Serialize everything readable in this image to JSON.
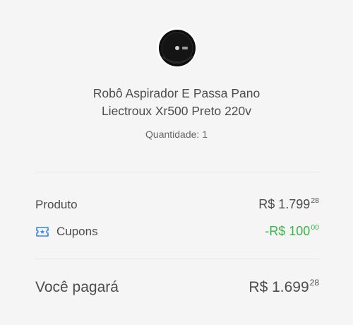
{
  "product": {
    "image_icon": "robot-vacuum",
    "title_line1": "Robô Aspirador E Passa Pano",
    "title_line2": "Liectroux Xr500 Preto 220v",
    "quantity": "Quantidade: 1"
  },
  "summary": {
    "product_label": "Produto",
    "product_price_main": "R$ 1.799",
    "product_price_cents": "28",
    "coupons_icon": "ticket-star-icon",
    "coupons_label": "Cupons",
    "coupons_price_main": "-R$ 100",
    "coupons_price_cents": "00",
    "total_label": "Você pagará",
    "total_price_main": "R$ 1.699",
    "total_price_cents": "28"
  },
  "colors": {
    "background": "#f5f5f5",
    "text": "#4d4d4d",
    "discount": "#39b54a",
    "coupon_icon": "#3483fa",
    "divider": "#e6e6e6"
  }
}
